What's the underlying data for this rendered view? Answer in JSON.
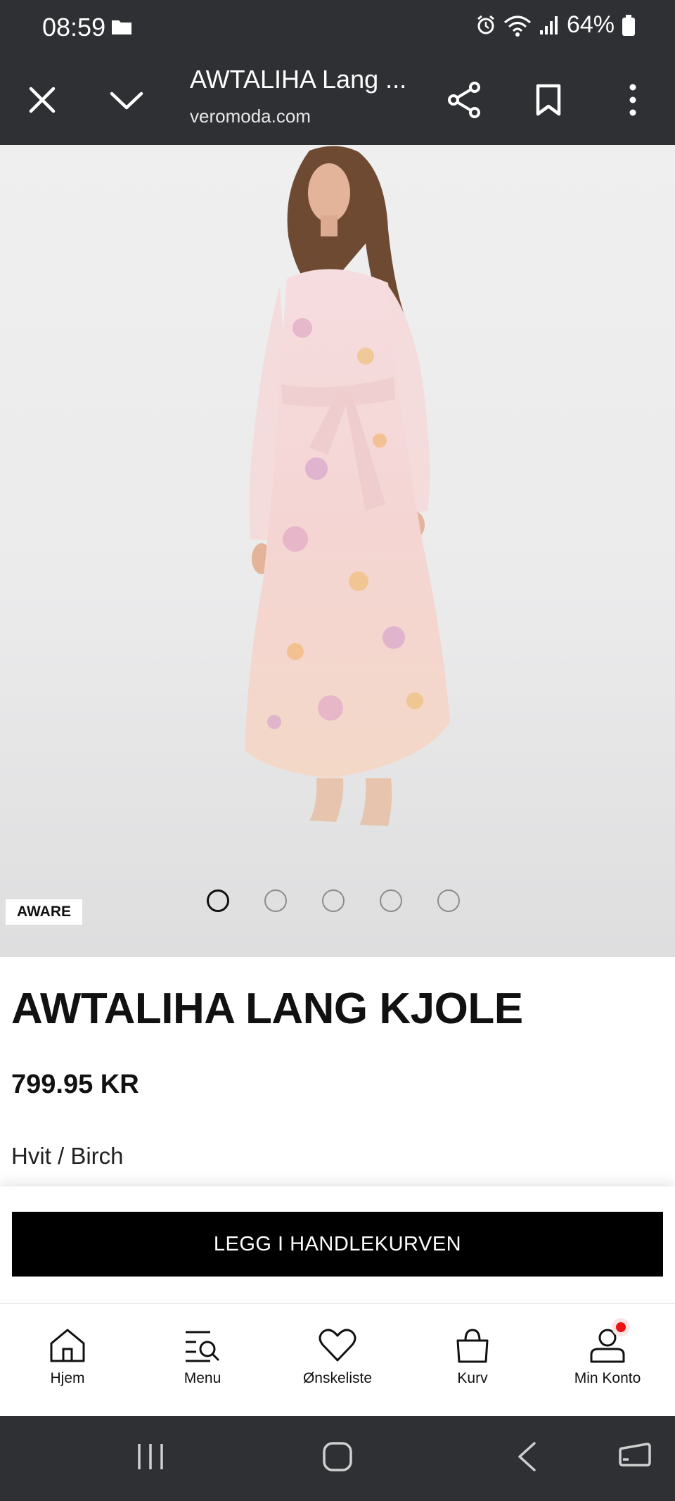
{
  "status_bar": {
    "time": "08:59",
    "battery": "64%"
  },
  "browser": {
    "title": "AWTALIHA Lang ...",
    "url": "veromoda.com"
  },
  "product": {
    "badge": "AWARE",
    "carousel": {
      "total": 5,
      "active": 1
    },
    "name": "AWTALIHA LANG KJOLE",
    "price": "799.95 KR",
    "color": "Hvit / Birch",
    "cta": "LEGG I HANDLEKURVEN"
  },
  "bottom_nav": {
    "home": "Hjem",
    "menu": "Menu",
    "wishlist": "Ønskeliste",
    "cart": "Kurv",
    "account": "Min Konto"
  },
  "colors": {
    "dark_bar": "#2f3034",
    "cta_bg": "#000000",
    "notification_dot": "#ee1111"
  }
}
